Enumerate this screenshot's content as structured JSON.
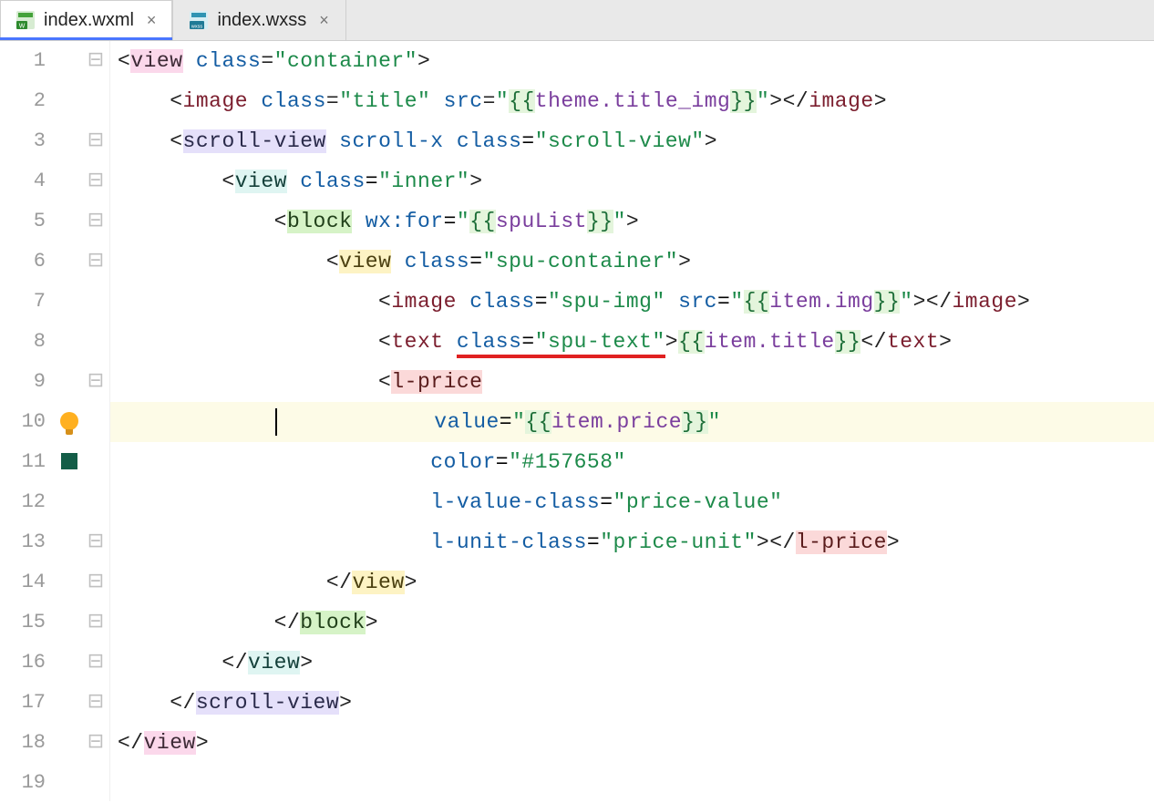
{
  "tabs": [
    {
      "label": "index.wxml",
      "active": true,
      "type": "wxml"
    },
    {
      "label": "index.wxss",
      "active": false,
      "type": "wxss"
    }
  ],
  "highlighted_line": 10,
  "line_numbers": [
    "1",
    "2",
    "3",
    "4",
    "5",
    "6",
    "7",
    "8",
    "9",
    "10",
    "11",
    "12",
    "13",
    "14",
    "15",
    "16",
    "17",
    "18",
    "19"
  ],
  "markers": {
    "10": "bulb",
    "11": "green-box"
  },
  "fold_icons": {
    "1": "minus",
    "3": "minus",
    "4": "minus",
    "5": "minus",
    "6": "minus",
    "9": "minus",
    "13": "minus",
    "14": "minus",
    "15": "minus",
    "16": "minus",
    "17": "minus",
    "18": "minus"
  },
  "tokens": {
    "open_angle": "<",
    "close_angle": ">",
    "slash": "/",
    "open_close": "</",
    "space": " ",
    "eq": "=",
    "quote": "\""
  },
  "tags": {
    "view": "view",
    "image": "image",
    "scroll_view": "scroll-view",
    "block": "block",
    "text": "text",
    "l_price": "l-price"
  },
  "attrs_kw": {
    "class": "class",
    "src": "src",
    "scroll_x": "scroll-x",
    "wx_for": "wx:for",
    "value": "value",
    "color": "color",
    "l_value_class": "l-value-class",
    "l_unit_class": "l-unit-class"
  },
  "values": {
    "container": "container",
    "title": "title",
    "scroll_view": "scroll-view",
    "inner": "inner",
    "spu_container": "spu-container",
    "spu_img": "spu-img",
    "spu_text": "spu-text",
    "price_value": "price-value",
    "price_unit": "price-unit",
    "color_hex": "#157658",
    "theme_title": "theme.title_img",
    "spuList": "spuList",
    "item_img": "item.img",
    "item_title": "item.title",
    "item_price": "item.price"
  },
  "braces": {
    "dl": "{{",
    "dr": "}}"
  }
}
